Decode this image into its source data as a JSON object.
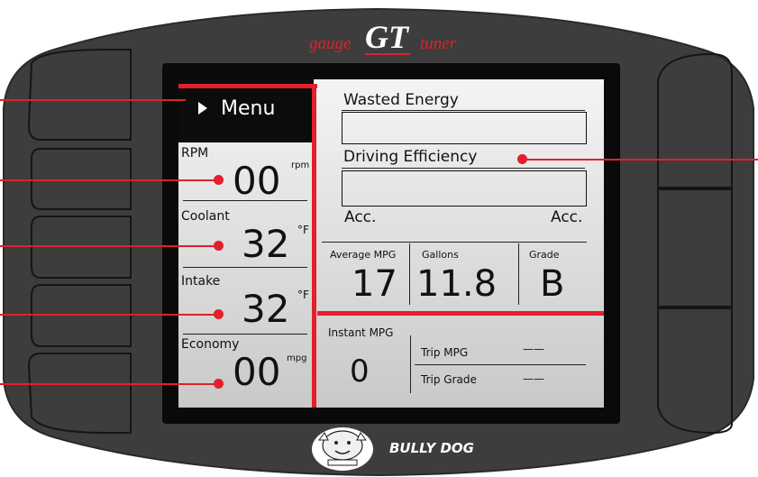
{
  "brand": {
    "gauge_word": "gauge",
    "gt_word": "GT",
    "tuner_word": "tuner",
    "maker": "BULLY DOG",
    "mascot_icon": "bulldog-logo-icon"
  },
  "menu": {
    "label": "Menu",
    "arrow_icon": "play-arrow-icon"
  },
  "gauges": [
    {
      "name": "RPM",
      "value": "00",
      "unit": "rpm"
    },
    {
      "name": "Coolant",
      "value": "32",
      "unit": "°F"
    },
    {
      "name": "Intake",
      "value": "32",
      "unit": "°F"
    },
    {
      "name": "Economy",
      "value": "00",
      "unit": "mpg"
    }
  ],
  "wasted_energy": {
    "label": "Wasted Energy"
  },
  "driving_efficiency": {
    "label": "Driving Efficiency",
    "left_label": "Acc.",
    "right_label": "Acc."
  },
  "stats": [
    {
      "label": "Average MPG",
      "value": "17"
    },
    {
      "label": "Gallons",
      "value": "11.8"
    },
    {
      "label": "Grade",
      "value": "B"
    }
  ],
  "instant": {
    "label": "Instant MPG",
    "value": "0"
  },
  "trip": [
    {
      "label": "Trip MPG",
      "value": "——"
    },
    {
      "label": "Trip Grade",
      "value": "——"
    }
  ],
  "colors": {
    "accent": "#e1202b",
    "bezel": "#3d3d3d",
    "screen": "#dcdcdc"
  }
}
